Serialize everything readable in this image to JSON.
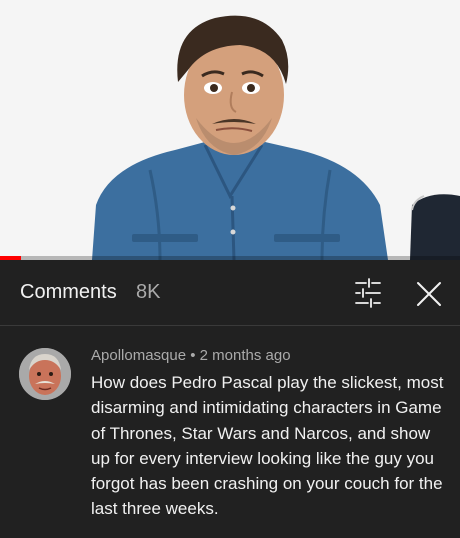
{
  "video": {
    "progress_fraction": 0.045,
    "accent": "#ff0000"
  },
  "comments_panel": {
    "title": "Comments",
    "count": "8K",
    "filter_icon": "sort-sliders-icon",
    "close_icon": "close-icon"
  },
  "comment": {
    "author": "Apollomasque",
    "separator": "•",
    "time": "2 months ago",
    "text": "How does Pedro Pascal play the slickest, most disarming and intimidating characters in Game of Thrones, Star Wars and Narcos, and show up for every interview looking like the guy you forgot has been crashing on your couch for the last three weeks."
  },
  "colors": {
    "panel_bg": "#212121",
    "primary_text": "#f1f1f1",
    "secondary_text": "#aaaaaa"
  }
}
